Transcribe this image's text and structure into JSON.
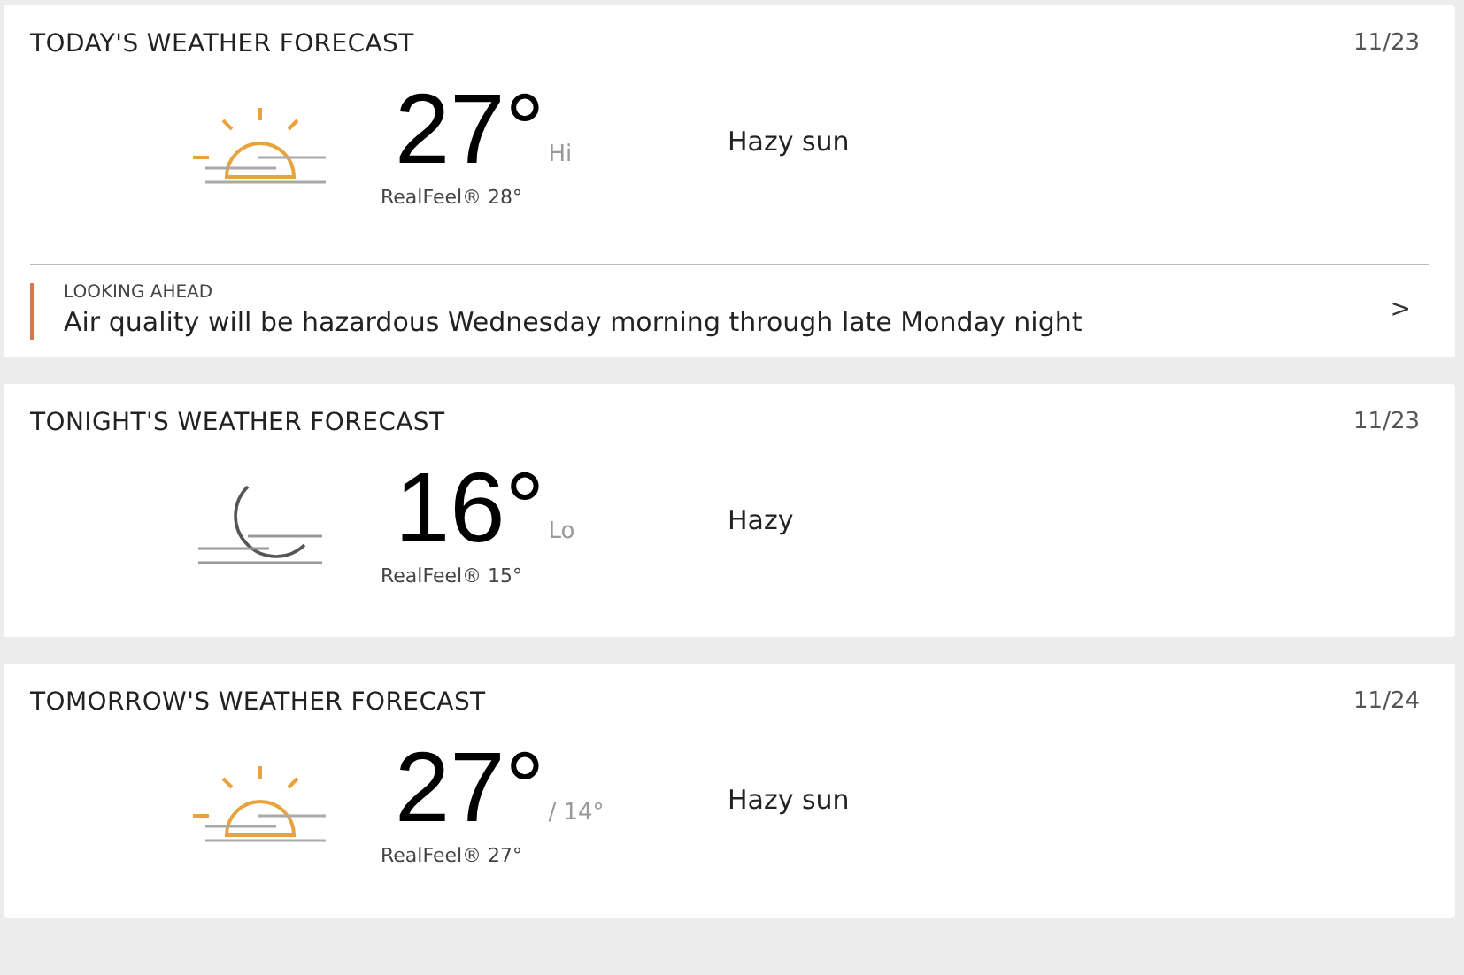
{
  "cards": [
    {
      "title": "TODAY'S WEATHER FORECAST",
      "date": "11/23",
      "kind": "sun",
      "temp": "27°",
      "sub": "Hi",
      "realfeel": "RealFeel® 28°",
      "condition": "Hazy sun",
      "looking_ahead": {
        "label": "LOOKING AHEAD",
        "text": "Air quality will be hazardous Wednesday morning through late Monday night",
        "chevron": ">"
      }
    },
    {
      "title": "TONIGHT'S WEATHER FORECAST",
      "date": "11/23",
      "kind": "moon",
      "temp": "16°",
      "sub": "Lo",
      "realfeel": "RealFeel® 15°",
      "condition": "Hazy"
    },
    {
      "title": "TOMORROW'S WEATHER FORECAST",
      "date": "11/24",
      "kind": "sun",
      "temp": "27°",
      "sub": "/ 14°",
      "realfeel": "RealFeel® 27°",
      "condition": "Hazy sun"
    }
  ]
}
